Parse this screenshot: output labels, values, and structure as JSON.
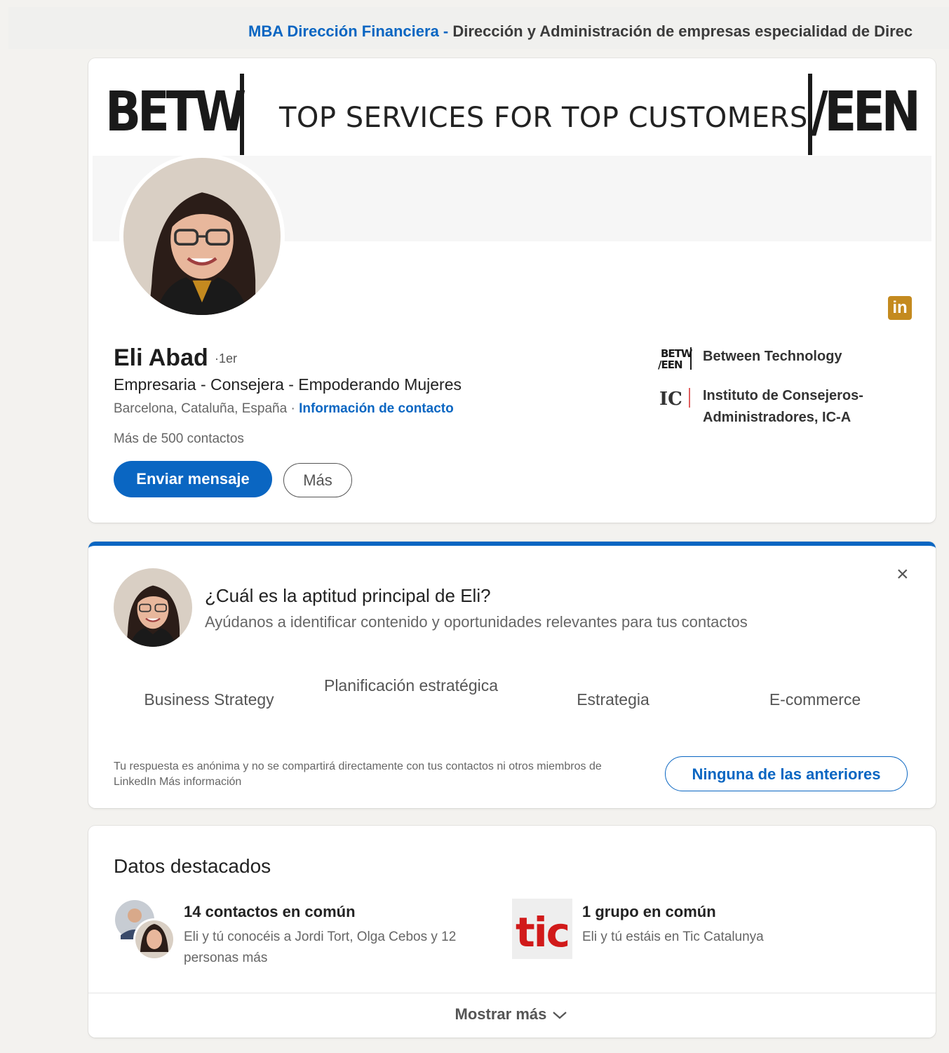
{
  "topbar": {
    "link": "MBA Dirección Financiera -",
    "rest": " Dirección y Administración de empresas especialidad de Direc"
  },
  "banner": {
    "brand_left": "BETW",
    "brand_right": "/EEN",
    "tagline": "TOP SERVICES FOR TOP CUSTOMERS"
  },
  "profile": {
    "name": "Eli Abad",
    "degree": "·1er",
    "headline": "Empresaria - Consejera - Empoderando Mujeres",
    "location": "Barcelona, Cataluña, España · ",
    "contact_info": "Información de contacto",
    "connections": "Más de 500 contactos",
    "message_button": "Enviar mensaje",
    "more_button": "Más",
    "linkedin_badge": "in",
    "companies": [
      {
        "name": "Between Technology",
        "logo_text": "BETW /EEN"
      },
      {
        "name": "Instituto de Consejeros-Administradores, IC-A",
        "logo_text": "IC"
      }
    ]
  },
  "skill_prompt": {
    "question": "¿Cuál es la aptitud principal de Eli?",
    "subtitle": "Ayúdanos a identificar contenido y oportunidades relevantes para tus contactos",
    "close_icon": "×",
    "options": [
      "Business Strategy",
      "Planificación estratégica",
      "Estrategia",
      "E-commerce"
    ],
    "footnote": "Tu respuesta es anónima y no se compartirá directamente con tus contactos ni otros miembros de LinkedIn Más información",
    "none_button": "Ninguna de las anteriores"
  },
  "highlights": {
    "title": "Datos destacados",
    "items": [
      {
        "title": "14 contactos en común",
        "subtitle": "Eli y tú conocéis a Jordi Tort, Olga Cebos y 12 personas más"
      },
      {
        "title": "1 grupo en común",
        "subtitle": "Eli y tú estáis en Tic Catalunya",
        "logo_text": "tic"
      }
    ],
    "show_more": "Mostrar más",
    "show_more_icon": "chevron-down-icon"
  },
  "colors": {
    "accent": "#0a66c2",
    "background": "#f3f2ef",
    "linkedin_badge": "#c48a1f",
    "tic_red": "#d11a1a"
  }
}
